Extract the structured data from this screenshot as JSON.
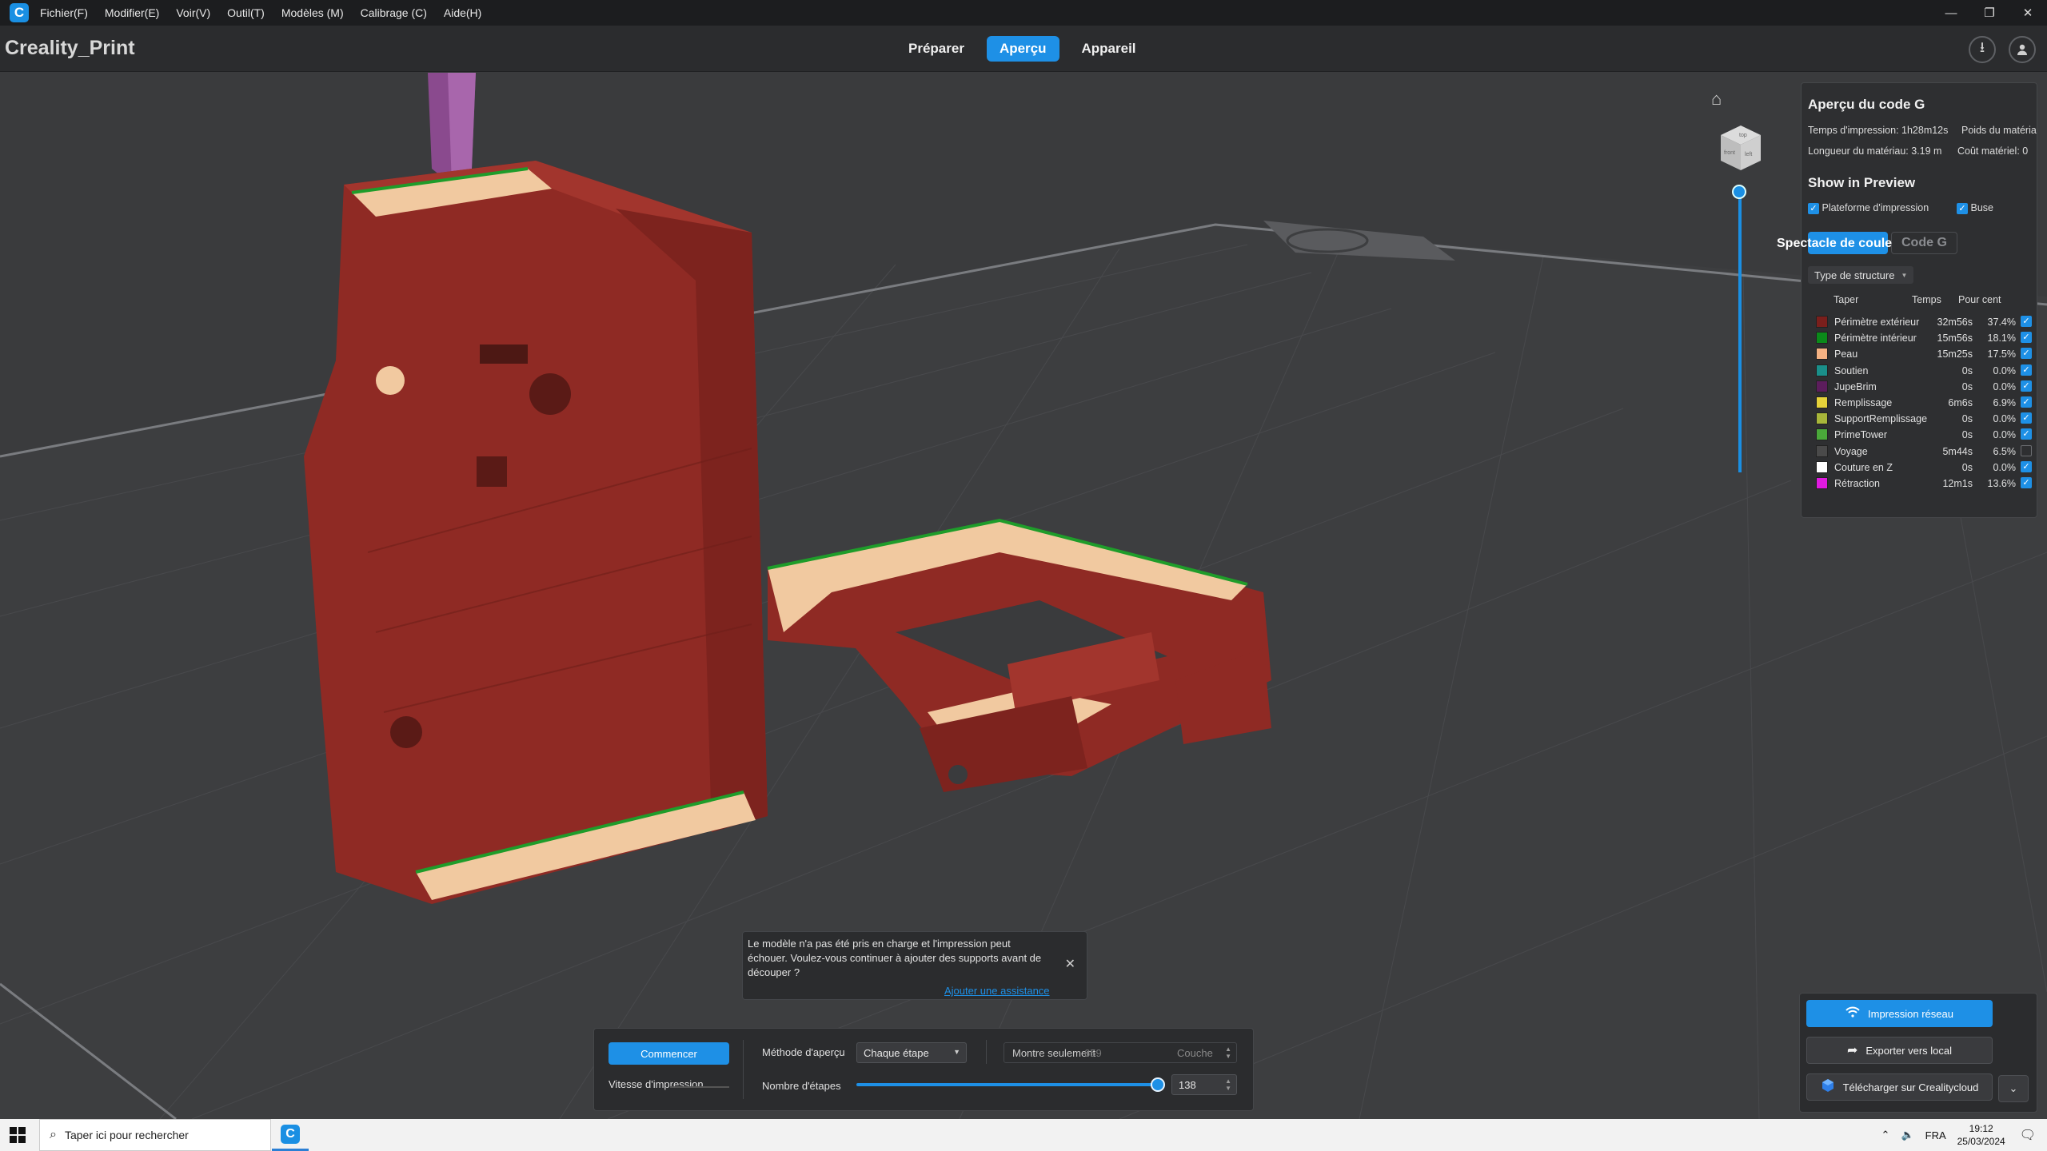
{
  "menubar": {
    "logo": "C",
    "items": [
      "Fichier(F)",
      "Modifier(E)",
      "Voir(V)",
      "Outil(T)",
      "Modèles (M)",
      "Calibrage (C)",
      "Aide(H)"
    ],
    "minimize_icon": "—",
    "restore_icon": "❐",
    "close_icon": "✕"
  },
  "header": {
    "title": "Creality_Print",
    "tabs": [
      {
        "label": "Préparer",
        "active": false
      },
      {
        "label": "Aperçu",
        "active": true
      },
      {
        "label": "Appareil",
        "active": false
      }
    ],
    "download_icon": "⭳",
    "user_icon": "👤"
  },
  "viewport": {
    "home_icon": "⌂",
    "cube_faces": {
      "top": "top",
      "left": "left",
      "front": "front"
    }
  },
  "gcode_panel": {
    "title": "Aperçu du code G",
    "print_time": "Temps d'impression: 1h28m12s",
    "material_weight": "Poids du matériau",
    "material_length": "Longueur du matériau: 3.19 m",
    "material_cost": "Coût matériel: 0",
    "show_in_preview": "Show in Preview",
    "show_platform": {
      "label": "Plateforme d'impression",
      "checked": true
    },
    "show_nozzle": {
      "label": "Buse",
      "checked": true
    },
    "view_tabs": [
      {
        "label": "Spectacle de coule",
        "active": true
      },
      {
        "label": "Code G",
        "active": false
      }
    ],
    "structure_dropdown": "Type de structure",
    "legend_headers": {
      "type": "Taper",
      "time": "Temps",
      "percent": "Pour cent"
    },
    "legend": [
      {
        "color": "#7a1f1c",
        "name": "Périmètre extérieur",
        "time": "32m56s",
        "percent": "37.4%",
        "checked": true
      },
      {
        "color": "#0b8a1a",
        "name": "Périmètre intérieur",
        "time": "15m56s",
        "percent": "18.1%",
        "checked": true
      },
      {
        "color": "#f4b183",
        "name": "Peau",
        "time": "15m25s",
        "percent": "17.5%",
        "checked": true
      },
      {
        "color": "#1a8f8a",
        "name": "Soutien",
        "time": "0s",
        "percent": "0.0%",
        "checked": true
      },
      {
        "color": "#5c1d5c",
        "name": "JupeBrim",
        "time": "0s",
        "percent": "0.0%",
        "checked": true
      },
      {
        "color": "#e6d23a",
        "name": "Remplissage",
        "time": "6m6s",
        "percent": "6.9%",
        "checked": true
      },
      {
        "color": "#a8b63a",
        "name": "SupportRemplissage",
        "time": "0s",
        "percent": "0.0%",
        "checked": true
      },
      {
        "color": "#4aa83a",
        "name": "PrimeTower",
        "time": "0s",
        "percent": "0.0%",
        "checked": true
      },
      {
        "color": "#4a4a4a",
        "name": "Voyage",
        "time": "5m44s",
        "percent": "6.5%",
        "checked": false
      },
      {
        "color": "#ffffff",
        "name": "Couture en Z",
        "time": "0s",
        "percent": "0.0%",
        "checked": true
      },
      {
        "color": "#e01ae0",
        "name": "Rétraction",
        "time": "12m1s",
        "percent": "13.6%",
        "checked": true
      }
    ]
  },
  "notice": {
    "text": "Le modèle n'a pas été pris en charge et l'impression peut échouer. Voulez-vous continuer à ajouter des supports avant de découper ?",
    "link": "Ajouter une assistance",
    "close_icon": "✕"
  },
  "control_bar": {
    "start_button": "Commencer",
    "speed_label": "Vitesse d'impression",
    "preview_method_label": "Méthode d'aperçu",
    "preview_method_value": "Chaque étape",
    "show_only_label": "Montre seulement",
    "show_only_value": "659",
    "show_only_unit": "Couche",
    "steps_label": "Nombre d'étapes",
    "steps_value": "138",
    "steps_fraction": 1.0
  },
  "export": {
    "network_print": "Impression réseau",
    "export_local": "Exporter vers local",
    "upload_cloud": "Télécharger sur Crealitycloud",
    "more_icon": "⌄"
  },
  "taskbar": {
    "search_placeholder": "Taper ici pour rechercher",
    "language": "FRA",
    "time": "19:12",
    "date": "25/03/2024"
  },
  "colors": {
    "accent": "#1e90e6",
    "model_red": "#8f2a24"
  }
}
